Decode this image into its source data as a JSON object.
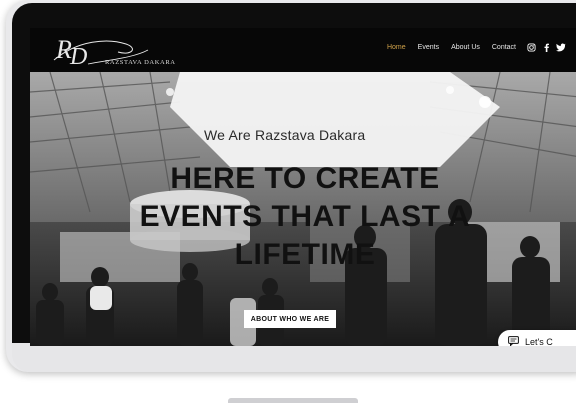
{
  "site": {
    "logo_monogram": "RD",
    "brand": "RAZSTAVA DAKARA"
  },
  "nav": {
    "items": [
      "Home",
      "Events",
      "About Us",
      "Contact"
    ],
    "active_index": 0
  },
  "social": {
    "icons": [
      "instagram-icon",
      "facebook-icon",
      "twitter-icon"
    ],
    "glyphs": [
      "◎",
      "f",
      "🐦"
    ]
  },
  "hero": {
    "subtitle": "We Are Razstava Dakara",
    "headline_lines": [
      "HERE TO CREATE",
      "EVENTS THAT LAST A",
      "LIFETIME"
    ],
    "cta_label": "ABOUT WHO WE ARE"
  },
  "chat": {
    "label": "Let's C"
  },
  "colors": {
    "accent": "#d0a24a",
    "topbar": "#070707",
    "headline": "#111111"
  }
}
